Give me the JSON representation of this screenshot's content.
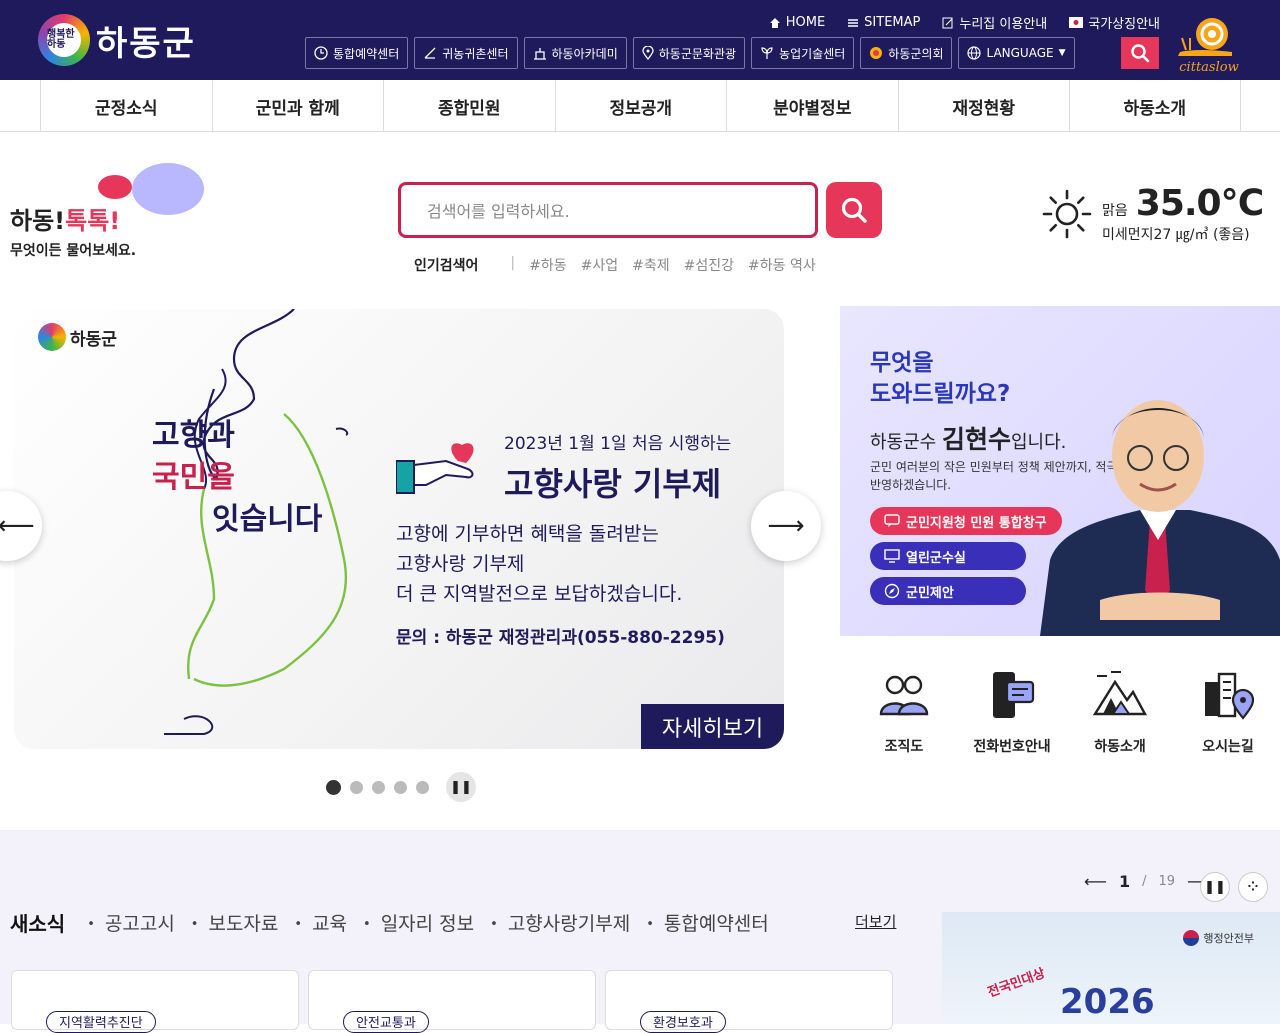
{
  "header": {
    "logo_badge": "행복한 하동",
    "logo_text": "하동군",
    "util_links": [
      "HOME",
      "SITEMAP",
      "누리집 이용안내",
      "국가상징안내"
    ],
    "quick_links": [
      "통합예약센터",
      "귀농귀촌센터",
      "하동아카데미",
      "하동군문화관광",
      "농업기술센터",
      "하동군의회",
      "LANGUAGE"
    ],
    "cittaslow": "cittaslow"
  },
  "gnb": [
    "군정소식",
    "군민과 함께",
    "종합민원",
    "정보공개",
    "분야별정보",
    "재정현황",
    "하동소개"
  ],
  "talk": {
    "title_a": "하동!",
    "title_b": "톡톡!",
    "sub": "무엇이든 물어보세요."
  },
  "search": {
    "placeholder": "검색어를 입력하세요.",
    "popular_label": "인기검색어",
    "keywords": [
      "#하동",
      "#사업",
      "#축제",
      "#섬진강",
      "#하동 역사"
    ]
  },
  "weather": {
    "status": "맑음",
    "temp": "35.0℃",
    "dust": "미세먼지27 ㎍/㎥ (좋음)"
  },
  "banner": {
    "logo": "하동군",
    "slogan_a": "고향과",
    "slogan_b": "국민을",
    "slogan_c": "잇습니다",
    "sub": "2023년 1월 1일 처음 시행하는",
    "title": "고향사랑 기부제",
    "desc1": "고향에 기부하면 혜택을 돌려받는",
    "desc2": "고향사랑 기부제",
    "desc3": "더 큰 지역발전으로 보답하겠습니다.",
    "inquiry": "문의 : 하동군 재정관리과(055-880-2295)",
    "more": "자세히보기",
    "slides_total": 5,
    "slide_current": 1
  },
  "mayor": {
    "line1": "무엇을",
    "line2": "도와드릴까요?",
    "intro_a": "하동군수 ",
    "intro_name": "김현수",
    "intro_b": "입니다.",
    "desc": "군민 여러분의 작은 민원부터 정책 제안까지, 적극 반영하겠습니다.",
    "buttons": [
      "군민지원청 민원 통합창구",
      "열린군수실",
      "군민제안"
    ]
  },
  "quick_icons": [
    "조직도",
    "전화번호안내",
    "하동소개",
    "오시는길"
  ],
  "news": {
    "current": "새소식",
    "tabs": [
      "공고고시",
      "보도자료",
      "교육",
      "일자리 정보",
      "고향사랑기부제",
      "통합예약센터"
    ],
    "more": "더보기",
    "cards": [
      "지역활력추진단",
      "안전교통과",
      "환경보호과"
    ]
  },
  "pager": {
    "current": "1",
    "sep": "/",
    "total": "19"
  },
  "award": {
    "org": "행정안전부",
    "national": "전국민대상",
    "year": "2026"
  },
  "colors": {
    "navy": "#1f1a5c",
    "accent": "#e6375a",
    "mayor_bg": "#d7d3ff"
  }
}
